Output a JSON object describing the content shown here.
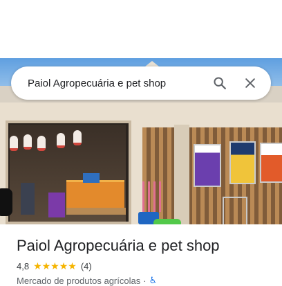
{
  "search": {
    "query": "Paiol Agropecuária e pet shop"
  },
  "place": {
    "name": "Paiol Agropecuária e pet shop",
    "rating_value": "4,8",
    "stars": "★★★★★",
    "review_count": "(4)",
    "category": "Mercado de produtos agrícolas",
    "separator": "·",
    "accessibility_icon": "wheelchair-icon",
    "accessibility_glyph": "♿"
  },
  "colors": {
    "star": "#f5b400",
    "accessibility": "#1a73e8",
    "title": "#202124"
  }
}
